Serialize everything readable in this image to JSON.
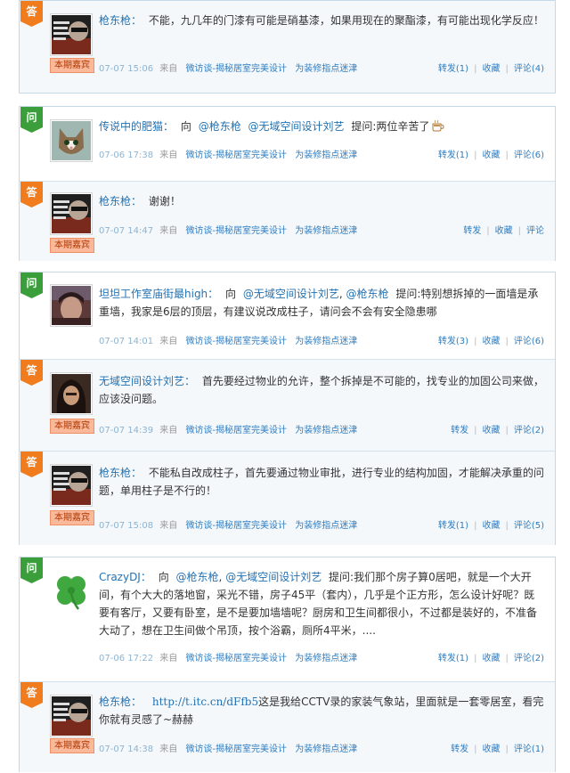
{
  "colors": {
    "accent": "#2472b2",
    "badge_question": "#3a9e3a",
    "badge_answer": "#f07c1e",
    "tag_bg": "#f9b99a"
  },
  "common": {
    "source_label": "来自",
    "source_1": "微访谈-揭秘居室完美设计",
    "source_2": "为装修指点迷津",
    "featured_tag": "本期嘉宾",
    "q_badge": "问",
    "a_badge": "答",
    "reply_prefix": "向",
    "ask_label": "提问:"
  },
  "threads": [
    {
      "answer_top": {
        "name": "枪东枪：",
        "text": "不能，九几年的门漆有可能是硝基漆，如果用现在的聚酯漆，有可能出现化学反应！",
        "time": "07-07 15:06",
        "forward": "转发(1)",
        "favorite": "收藏",
        "comment": "评论(4)"
      }
    },
    {
      "question": {
        "name": "传说中的肥猫：",
        "mention_1": "@枪东枪",
        "mention_2": "@无域空间设计刘艺",
        "text": "两位辛苦了",
        "emoticon": "coffee-cup-icon",
        "time": "07-06 17:38",
        "forward": "转发(1)",
        "favorite": "收藏",
        "comment": "评论(6)"
      },
      "answer": {
        "name": "枪东枪：",
        "text": "谢谢！",
        "time": "07-07 14:47",
        "forward": "转发",
        "favorite": "收藏",
        "comment": "评论"
      }
    },
    {
      "question": {
        "name": "坦坦工作室庙街最high：",
        "mention_1": "@无域空间设计刘艺",
        "mention_2": "@枪东枪",
        "text": "特别想拆掉的一面墙是承重墙，我家是6层的顶层，有建议说改成柱子，请问会不会有安全隐患哪",
        "time": "07-07 14:01",
        "forward": "转发(3)",
        "favorite": "收藏",
        "comment": "评论(6)"
      },
      "answer_1": {
        "name": "无域空间设计刘艺：",
        "text": "首先要经过物业的允许，整个拆掉是不可能的，找专业的加固公司来做，应该没问题。",
        "time": "07-07 14:39",
        "forward": "转发",
        "favorite": "收藏",
        "comment": "评论(2)"
      },
      "answer_2": {
        "name": "枪东枪：",
        "text": "不能私自改成柱子，首先要通过物业审批，进行专业的结构加固，才能解决承重的问题，单用柱子是不行的！",
        "time": "07-07 15:08",
        "forward": "转发(1)",
        "favorite": "收藏",
        "comment": "评论(5)"
      }
    },
    {
      "question": {
        "name": "CrazyDJ：",
        "mention_1": "@枪东枪",
        "mention_2": "@无域空间设计刘艺",
        "text": "我们那个房子算0居吧，就是一个大开间，有个大大的落地窗，采光不错，房子45平（套内），几乎是个正方形，怎么设计好呢？既要有客厅，又要有卧室，是不是要加墙墙呢？厨房和卫生间都很小，不过都是装好的，不准备大动了，想在卫生间做个吊顶，按个浴霸，厕所4平米，....",
        "time": "07-06 17:22",
        "forward": "转发(1)",
        "favorite": "收藏",
        "comment": "评论(2)"
      },
      "answer": {
        "name": "枪东枪：",
        "link": "http://t.itc.cn/dFfb5",
        "text": "这是我给CCTV录的家装气象站，里面就是一套零居室，看完你就有灵感了~赫赫",
        "time": "07-07 14:38",
        "forward": "转发",
        "favorite": "收藏",
        "comment": "评论(1)"
      }
    }
  ]
}
